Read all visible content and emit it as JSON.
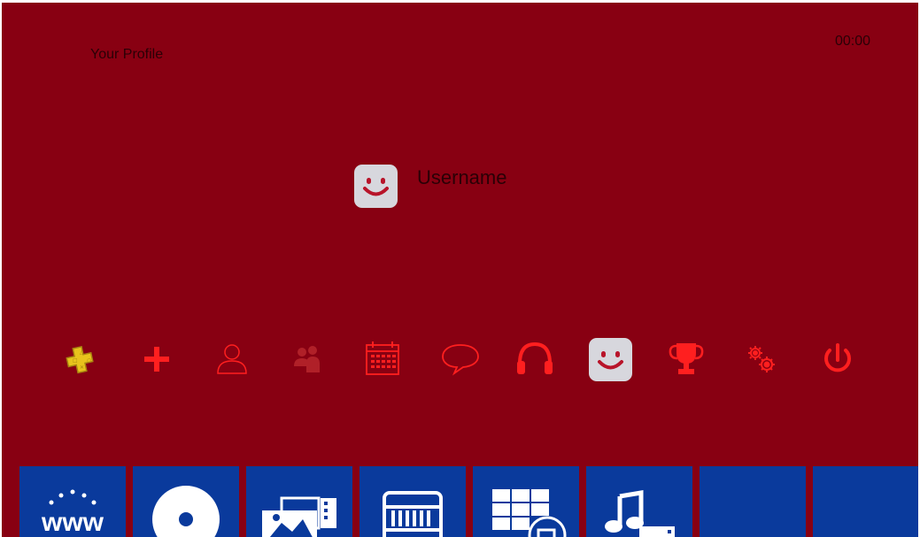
{
  "header": {
    "title": "Your Profile",
    "clock": "00:00"
  },
  "profile": {
    "username": "Username",
    "avatar_icon": "smiley-avatar-icon"
  },
  "function_bar": {
    "icon_color": "#ff1f1f",
    "items": [
      {
        "name": "playstation-plus-icon"
      },
      {
        "name": "whats-new-plus-icon"
      },
      {
        "name": "friends-icon"
      },
      {
        "name": "party-icon"
      },
      {
        "name": "events-calendar-icon"
      },
      {
        "name": "messages-icon"
      },
      {
        "name": "music-headphones-icon"
      },
      {
        "name": "profile-avatar-icon",
        "selected": true
      },
      {
        "name": "trophies-icon"
      },
      {
        "name": "settings-icon"
      },
      {
        "name": "power-icon"
      }
    ]
  },
  "tiles": {
    "color": "#0a3a9c",
    "items": [
      {
        "name": "internet-browser-tile",
        "label": "www"
      },
      {
        "name": "disc-tile"
      },
      {
        "name": "gallery-tile"
      },
      {
        "name": "library-tile"
      },
      {
        "name": "store-tile"
      },
      {
        "name": "music-tile"
      },
      {
        "name": "blank-tile-1"
      },
      {
        "name": "blank-tile-2"
      }
    ]
  }
}
